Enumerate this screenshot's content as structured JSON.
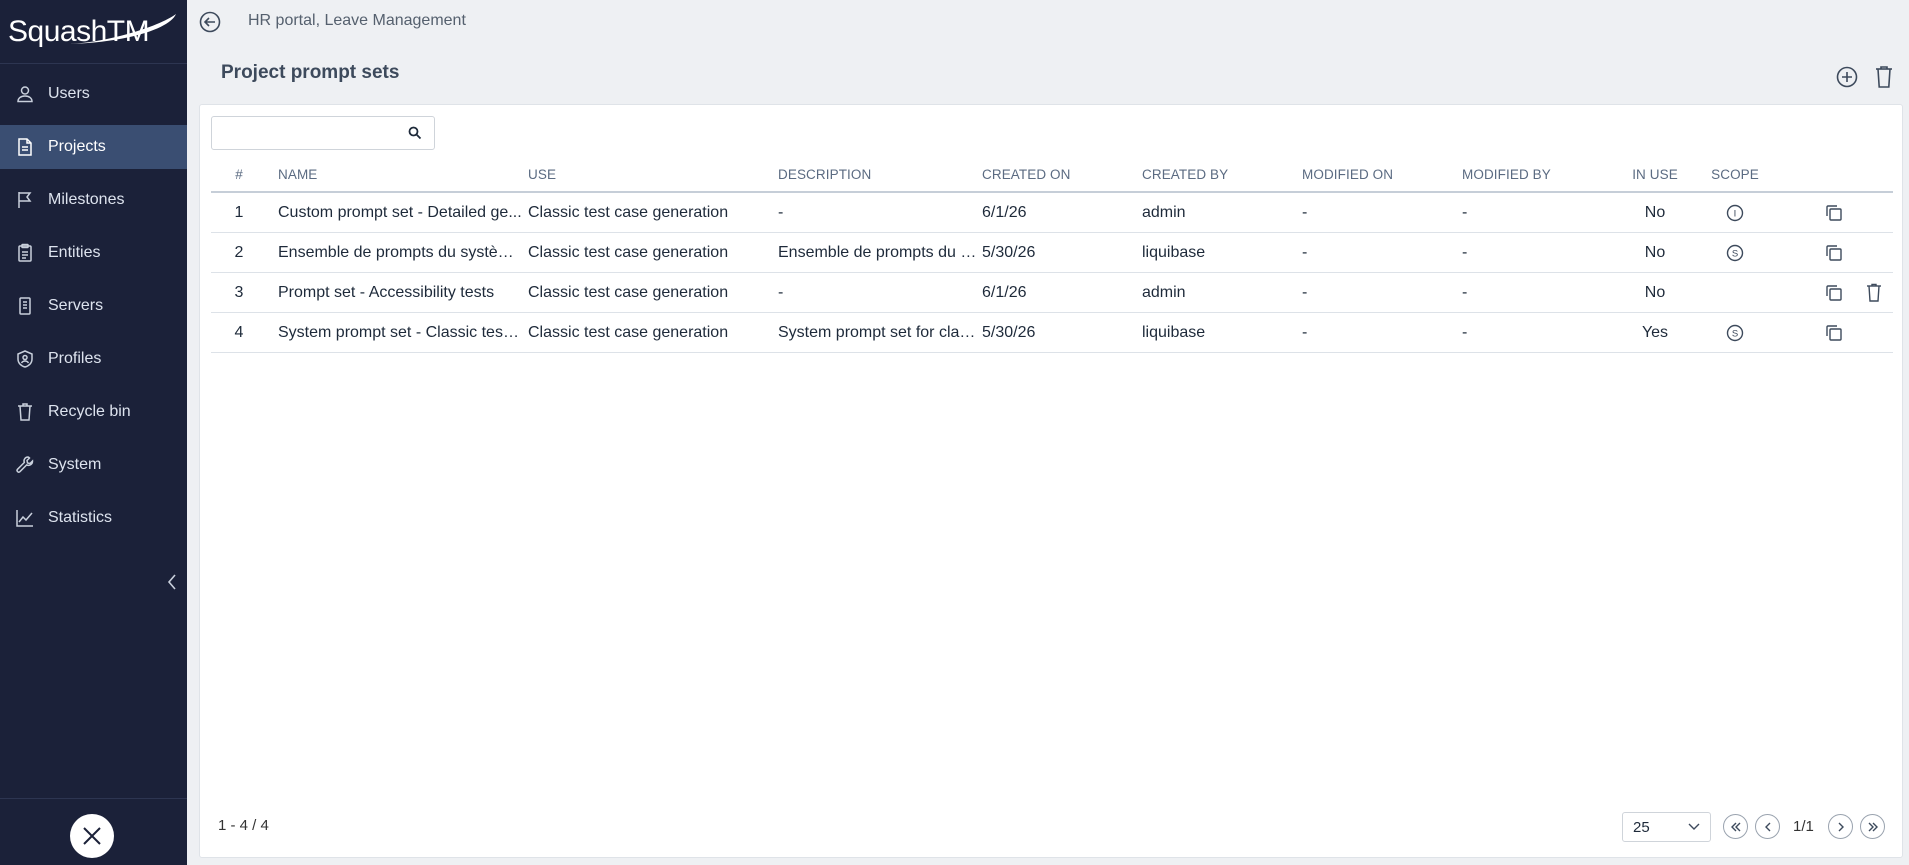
{
  "app": {
    "logo_text": "SquashTM"
  },
  "sidebar": {
    "items": [
      {
        "label": "Users",
        "icon": "user-icon",
        "active": false
      },
      {
        "label": "Projects",
        "icon": "document-icon",
        "active": true
      },
      {
        "label": "Milestones",
        "icon": "flag-icon",
        "active": false
      },
      {
        "label": "Entities",
        "icon": "clipboard-icon",
        "active": false
      },
      {
        "label": "Servers",
        "icon": "server-icon",
        "active": false
      },
      {
        "label": "Profiles",
        "icon": "shield-user-icon",
        "active": false
      },
      {
        "label": "Recycle bin",
        "icon": "trash-icon",
        "active": false
      },
      {
        "label": "System",
        "icon": "wrench-icon",
        "active": false
      },
      {
        "label": "Statistics",
        "icon": "line-chart-icon",
        "active": false
      }
    ]
  },
  "header": {
    "breadcrumb": "HR portal, Leave Management"
  },
  "page": {
    "title": "Project prompt sets"
  },
  "search": {
    "value": "",
    "placeholder": ""
  },
  "table": {
    "columns": [
      "#",
      "NAME",
      "USE",
      "DESCRIPTION",
      "CREATED ON",
      "CREATED BY",
      "MODIFIED ON",
      "MODIFIED BY",
      "IN USE",
      "SCOPE"
    ],
    "rows": [
      {
        "num": "1",
        "name": "Custom prompt set - Detailed ge...",
        "use": "Classic test case generation",
        "description": "-",
        "created_on": "6/1/26",
        "created_by": "admin",
        "modified_on": "-",
        "modified_by": "-",
        "in_use": "No",
        "scope": "I",
        "deletable": false
      },
      {
        "num": "2",
        "name": "Ensemble de prompts du systèm...",
        "use": "Classic test case generation",
        "description": "Ensemble de prompts du s...",
        "created_on": "5/30/26",
        "created_by": "liquibase",
        "modified_on": "-",
        "modified_by": "-",
        "in_use": "No",
        "scope": "S",
        "deletable": false
      },
      {
        "num": "3",
        "name": "Prompt set - Accessibility tests",
        "use": "Classic test case generation",
        "description": "-",
        "created_on": "6/1/26",
        "created_by": "admin",
        "modified_on": "-",
        "modified_by": "-",
        "in_use": "No",
        "scope": "",
        "deletable": true
      },
      {
        "num": "4",
        "name": "System prompt set - Classic test ...",
        "use": "Classic test case generation",
        "description": "System prompt set for clas...",
        "created_on": "5/30/26",
        "created_by": "liquibase",
        "modified_on": "-",
        "modified_by": "-",
        "in_use": "Yes",
        "scope": "S",
        "deletable": false
      }
    ]
  },
  "footer": {
    "count": "1 - 4 / 4",
    "page_size": "25",
    "page_label": "1/1"
  },
  "colors": {
    "sidebar_bg": "#1b2139",
    "sidebar_active": "#3a4e72",
    "page_bg": "#eef0f3",
    "accent": "#3d4a5c"
  }
}
